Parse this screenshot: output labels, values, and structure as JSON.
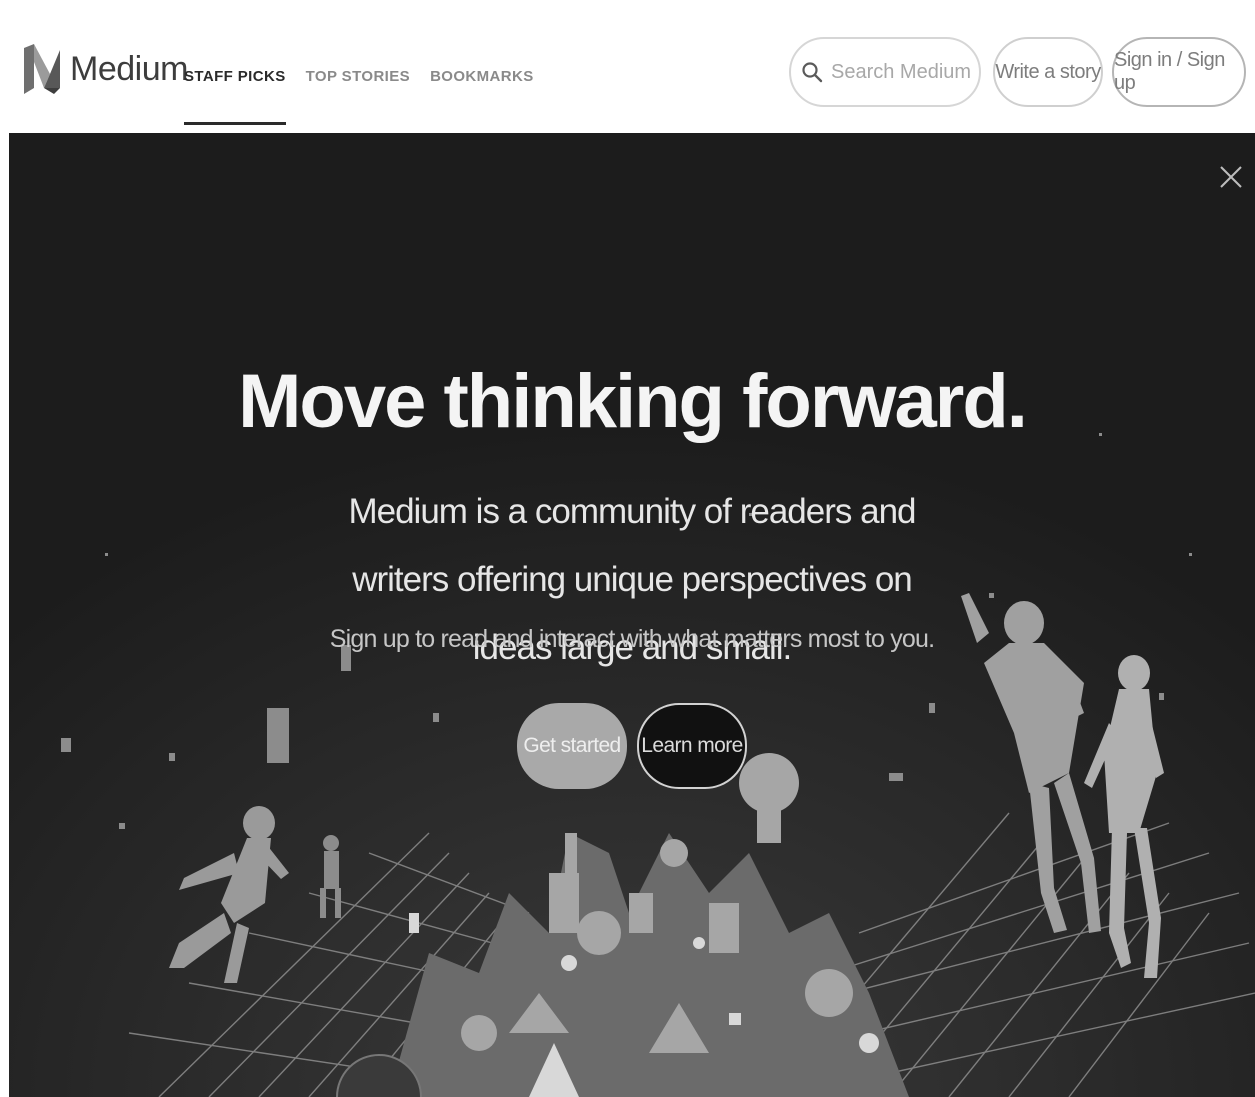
{
  "brand": {
    "name": "Medium",
    "logo_icon": "medium-logo-icon"
  },
  "nav": {
    "tabs": [
      {
        "label": "STAFF PICKS",
        "active": true
      },
      {
        "label": "TOP STORIES",
        "active": false
      },
      {
        "label": "BOOKMARKS",
        "active": false
      }
    ]
  },
  "search": {
    "placeholder": "Search Medium",
    "icon": "search-icon"
  },
  "header_actions": {
    "write_label": "Write a story",
    "signin_label": "Sign in / Sign up"
  },
  "hero": {
    "close_icon": "close-icon",
    "headline": "Move thinking forward.",
    "subtext": "Medium is a community of readers and writers offering unique perspectives on ideas large and small.",
    "cta_text": "Sign up to read and interact with what matters most to you.",
    "primary_button": "Get started",
    "secondary_button": "Learn more"
  },
  "colors": {
    "hero_background": "#1c1c1c",
    "header_background": "#ffffff",
    "primary_button": "#a9a9a9",
    "text_light": "#f4f4f4"
  }
}
